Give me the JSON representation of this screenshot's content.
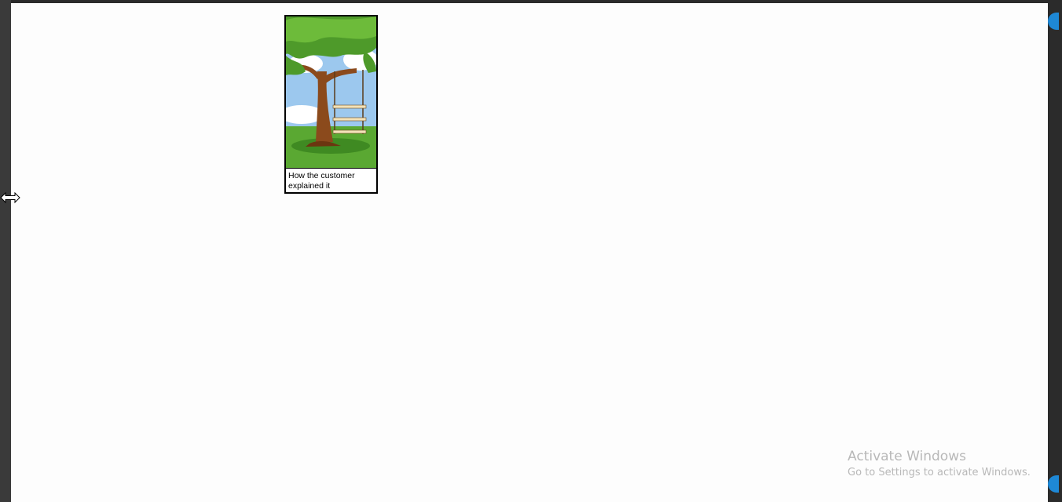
{
  "panel": {
    "caption": "How the customer explained it",
    "image_icon": "tree-swing-illustration-icon"
  },
  "cursor": {
    "icon": "horizontal-resize-cursor-icon"
  },
  "watermark": {
    "title": "Activate Windows",
    "subtitle": "Go to Settings to activate Windows."
  },
  "colors": {
    "accent": "#1e88d6",
    "background": "#fdfdfd",
    "frame": "#2b2b2b"
  }
}
